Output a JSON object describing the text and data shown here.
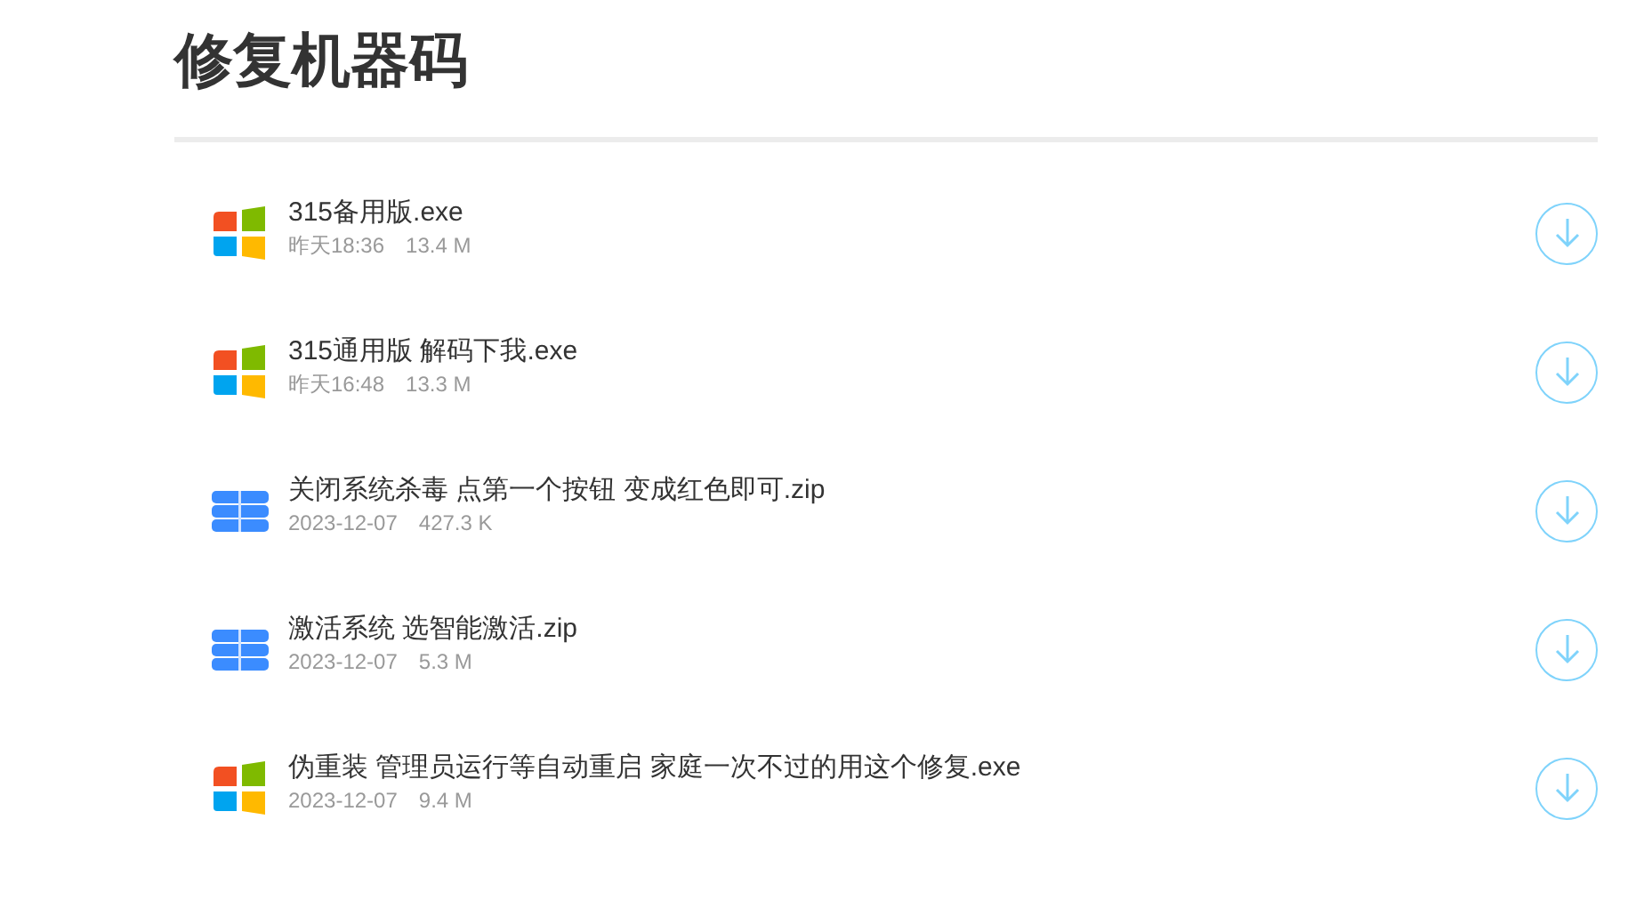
{
  "title": "修复机器码",
  "files": [
    {
      "kind": "exe",
      "name": "315备用版.exe",
      "date": "昨天18:36",
      "size": "13.4 M"
    },
    {
      "kind": "exe",
      "name": "315通用版 解码下我.exe",
      "date": "昨天16:48",
      "size": "13.3 M"
    },
    {
      "kind": "zip",
      "name": "关闭系统杀毒 点第一个按钮 变成红色即可.zip",
      "date": "2023-12-07",
      "size": "427.3 K"
    },
    {
      "kind": "zip",
      "name": "激活系统 选智能激活.zip",
      "date": "2023-12-07",
      "size": "5.3 M"
    },
    {
      "kind": "exe",
      "name": "伪重装 管理员运行等自动重启 家庭一次不过的用这个修复.exe",
      "date": "2023-12-07",
      "size": "9.4 M"
    }
  ]
}
